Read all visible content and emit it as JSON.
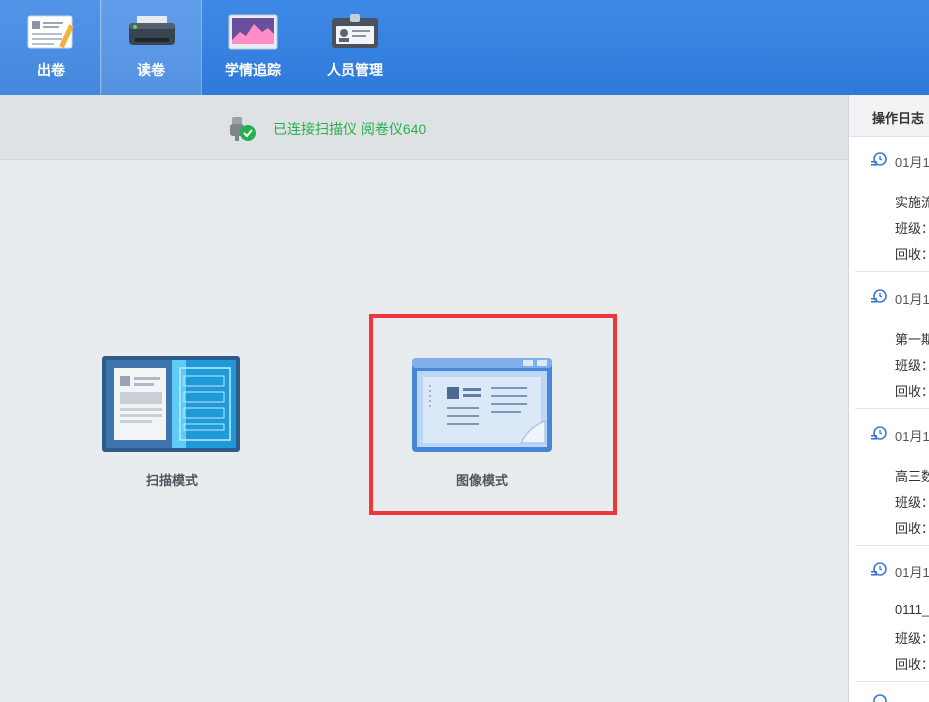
{
  "toolbar": {
    "items": [
      {
        "label": "出卷",
        "icon": "paper-icon"
      },
      {
        "label": "读卷",
        "icon": "printer-icon"
      },
      {
        "label": "学情追踪",
        "icon": "chart-icon"
      },
      {
        "label": "人员管理",
        "icon": "id-card-icon"
      }
    ],
    "active_index": 1,
    "accent": "#3583e0"
  },
  "status": {
    "text": "已连接扫描仪 阅卷仪640",
    "color": "#22b14c",
    "icon": "usb-connected-icon"
  },
  "modes": {
    "scan": {
      "label": "扫描模式",
      "icon": "scan-mode-icon"
    },
    "image": {
      "label": "图像模式",
      "icon": "image-mode-icon"
    }
  },
  "log_panel": {
    "title": "操作日志",
    "entries": [
      {
        "date": "01月1",
        "line1": "实施流",
        "line2": "班级：",
        "line3": "回收："
      },
      {
        "date": "01月1",
        "line1": "第一期",
        "line2": "班级：",
        "line3": "回收："
      },
      {
        "date": "01月1",
        "line1": "高三数",
        "line2": "班级：",
        "line3": "回收："
      },
      {
        "date": "01月1",
        "line1": "0111_",
        "line2": "班级：",
        "line3": "回收："
      }
    ]
  }
}
